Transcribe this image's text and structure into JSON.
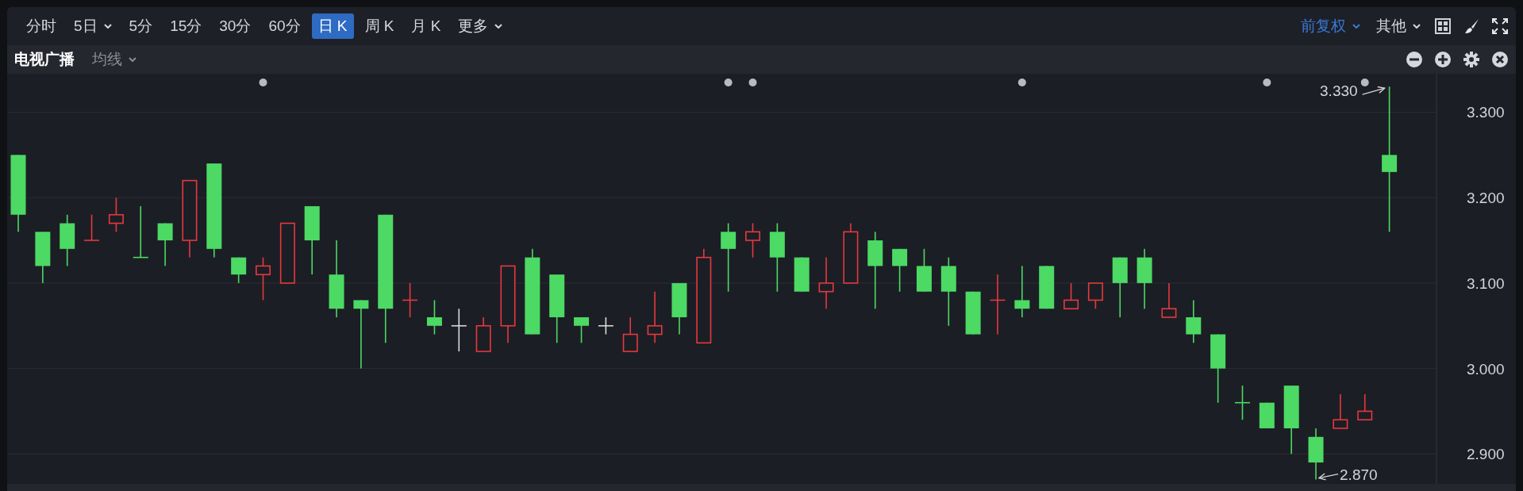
{
  "toolbar": {
    "periods": [
      {
        "label": "分时",
        "selected": false,
        "dropdown": false
      },
      {
        "label": "5日",
        "selected": false,
        "dropdown": true
      },
      {
        "label": "5分",
        "selected": false,
        "dropdown": false
      },
      {
        "label": "15分",
        "selected": false,
        "dropdown": false
      },
      {
        "label": "30分",
        "selected": false,
        "dropdown": false
      },
      {
        "label": "60分",
        "selected": false,
        "dropdown": false
      },
      {
        "label": "日 K",
        "selected": true,
        "dropdown": false
      },
      {
        "label": "周 K",
        "selected": false,
        "dropdown": false
      },
      {
        "label": "月 K",
        "selected": false,
        "dropdown": false
      },
      {
        "label": "更多",
        "selected": false,
        "dropdown": true
      }
    ],
    "options": [
      {
        "label": "前复权",
        "selected": true
      },
      {
        "label": "其他",
        "selected": false
      }
    ]
  },
  "chart_header": {
    "title": "电视广播",
    "indicator": "均线"
  },
  "price_chart": {
    "kind": "picture",
    "axis_labels": [
      "3.300",
      "3.200",
      "3.100",
      "3.000",
      "2.900"
    ],
    "high_label": "3.330",
    "low_label": "2.870"
  }
}
